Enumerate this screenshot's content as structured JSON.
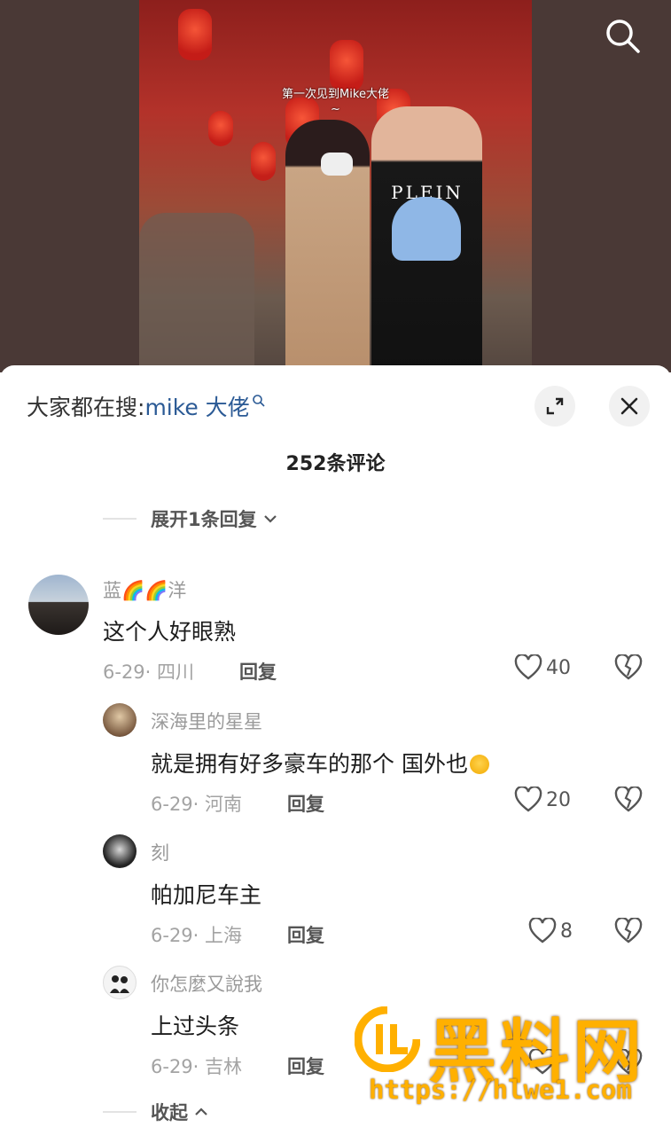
{
  "video": {
    "overlay_caption": "第一次见到Mike大佬",
    "overlay_tilde": "~",
    "shirt_text": "PLEIN"
  },
  "sheet": {
    "hot_search_prefix": "大家都在搜:",
    "hot_search_keyword": "mike 大佬",
    "comment_count": "252条评论",
    "expand_replies": "展开1条回复",
    "collapse": "收起"
  },
  "comments": [
    {
      "user": "蓝🌈🌈洋",
      "text": "这个人好眼熟",
      "date_loc": "6-29· 四川",
      "reply_label": "回复",
      "likes": "40"
    }
  ],
  "replies": [
    {
      "user": "深海里的星星",
      "text": "就是拥有好多豪车的那个 国外也",
      "date_loc": "6-29· 河南",
      "reply_label": "回复",
      "likes": "20"
    },
    {
      "user": "刻",
      "text": "帕加尼车主",
      "date_loc": "6-29· 上海",
      "reply_label": "回复",
      "likes": "8"
    },
    {
      "user": "你怎麼又說我",
      "text": "上过头条",
      "date_loc": "6-29· 吉林",
      "reply_label": "回复",
      "likes": ""
    }
  ],
  "watermark": {
    "title": "黑料网",
    "url": "https://hlwe1.com"
  },
  "icons": [
    "search-icon",
    "expand-icon",
    "close-icon",
    "heart-icon",
    "broken-heart-icon",
    "chevron-down-icon",
    "chevron-up-icon",
    "small-search-icon"
  ]
}
